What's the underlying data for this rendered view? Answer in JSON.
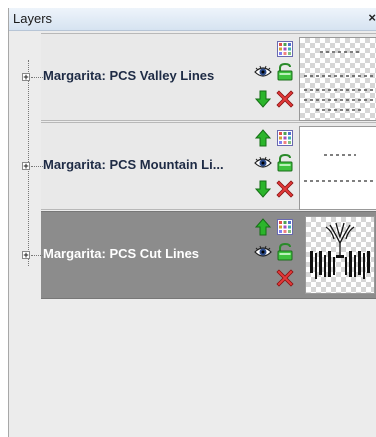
{
  "panel": {
    "title": "Layers",
    "close_glyph": "×"
  },
  "layers": [
    {
      "name": "Margarita: PCS Valley Lines",
      "selected": false,
      "buttons": [
        "grid-icon",
        "eye-icon",
        "lock-icon",
        "move-down-icon",
        "delete-icon"
      ]
    },
    {
      "name": "Margarita: PCS Mountain Li...",
      "selected": false,
      "buttons": [
        "move-up-icon",
        "grid-icon",
        "eye-icon",
        "lock-icon",
        "move-down-icon",
        "delete-icon"
      ]
    },
    {
      "name": "Margarita: PCS Cut Lines",
      "selected": true,
      "buttons": [
        "move-up-icon",
        "grid-icon",
        "eye-icon",
        "lock-icon",
        "delete-icon"
      ]
    }
  ],
  "colors": {
    "selected_row": "#8c8c8c",
    "arrow_green": "#1faa1f",
    "delete_red": "#e03030",
    "title_text": "#1e2b45"
  }
}
